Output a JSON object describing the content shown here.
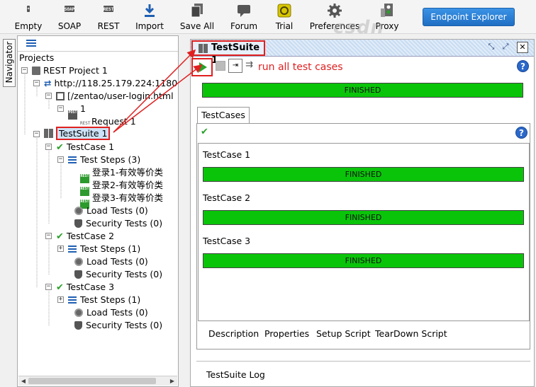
{
  "toolbar": {
    "buttons": [
      {
        "label": "Empty",
        "icon": "empty-project-icon",
        "badge": "*"
      },
      {
        "label": "SOAP",
        "icon": "soap-project-icon",
        "badge": "SOAP"
      },
      {
        "label": "REST",
        "icon": "rest-project-icon",
        "badge": "REST"
      },
      {
        "label": "Import",
        "icon": "import-icon",
        "badge": ""
      },
      {
        "label": "Save All",
        "icon": "save-all-icon",
        "badge": ""
      },
      {
        "label": "Forum",
        "icon": "forum-icon",
        "badge": ""
      },
      {
        "label": "Trial",
        "icon": "trial-icon",
        "badge": ""
      },
      {
        "label": "Preferences",
        "icon": "gear-icon",
        "badge": ""
      },
      {
        "label": "Proxy",
        "icon": "proxy-icon",
        "badge": ""
      }
    ],
    "endpoint_explorer": "Endpoint Explorer"
  },
  "watermark": "csdn",
  "navigator": {
    "tab_label": "Navigator"
  },
  "tree": {
    "root": "Projects",
    "project": "REST Project 1",
    "endpoint": "http://118.25.179.224:1180",
    "resource": "[/zentao/user-login.html",
    "method": "1",
    "method_badge": "POST",
    "request": "Request 1",
    "request_badge": "REST",
    "suite": "TestSuite 1",
    "cases": [
      {
        "name": "TestCase 1",
        "steps_label": "Test Steps (3)",
        "steps": [
          "登录1-有效等价类",
          "登录2-有效等价类",
          "登录3-有效等价类"
        ],
        "load": "Load Tests (0)",
        "security": "Security Tests (0)"
      },
      {
        "name": "TestCase 2",
        "steps_label": "Test Steps (1)",
        "load": "Load Tests (0)",
        "security": "Security Tests (0)"
      },
      {
        "name": "TestCase 3",
        "steps_label": "Test Steps (1)",
        "load": "Load Tests (0)",
        "security": "Security Tests (0)"
      }
    ]
  },
  "panel": {
    "title": "TestSuite 1",
    "annotation": "run all test cases",
    "suite_status": "FINISHED",
    "tab": "TestCases",
    "case_results": [
      {
        "name": "TestCase 1",
        "status": "FINISHED"
      },
      {
        "name": "TestCase 2",
        "status": "FINISHED"
      },
      {
        "name": "TestCase 3",
        "status": "FINISHED"
      }
    ],
    "bottom_tabs": [
      "Description",
      "Properties",
      "Setup Script",
      "TearDown Script"
    ],
    "log_label": "TestSuite Log",
    "help": "?",
    "step_badge": "REST"
  },
  "colors": {
    "finished": "#0ac40a",
    "annotation": "#e02020",
    "accent": "#1f6fc4",
    "pass": "#2aa02a"
  }
}
